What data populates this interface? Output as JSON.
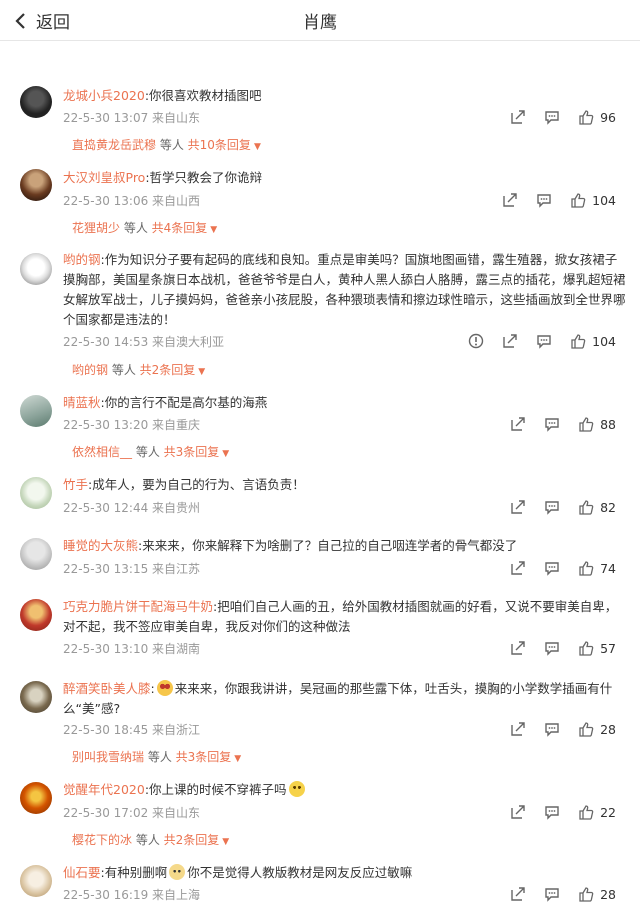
{
  "header": {
    "back_label": "返回",
    "title": "肖鹰"
  },
  "comments": [
    {
      "name": "龙城小兵2020",
      "text": ":你很喜欢教材插图吧",
      "meta": "22-5-30 13:07 来自山东",
      "likes": "96",
      "reply_name": "直捣黄龙岳武穆",
      "reply_mid": " 等人 ",
      "reply_more": "共10条回复"
    },
    {
      "name": "大汉刘皇叔Pro",
      "text": ":哲学只教会了你诡辩",
      "meta": "22-5-30 13:06 来自山西",
      "likes": "104",
      "reply_name": "花狸胡少",
      "reply_mid": " 等人 ",
      "reply_more": "共4条回复"
    },
    {
      "name": "哟的钢",
      "text": ":作为知识分子要有起码的底线和良知。重点是审美吗？国旗地图画错，露生殖器，掀女孩裙子摸胸部，美国星条旗日本战机，爸爸爷爷是白人，黄种人黑人舔白人胳膊，露三点的插花，爆乳超短裙女解放军战士，儿子摸妈妈，爸爸亲小孩屁股，各种猥琐表情和擦边球性暗示，这些插画放到全世界哪个国家都是违法的！",
      "meta": "22-5-30 14:53 来自澳大利亚",
      "likes": "104",
      "reply_name": "哟的钢",
      "reply_mid": " 等人 ",
      "reply_more": "共2条回复"
    },
    {
      "name": "晴蓝秋",
      "text": ":你的言行不配是高尔基的海燕",
      "meta": "22-5-30 13:20 来自重庆",
      "likes": "88",
      "reply_name": "依然相信__",
      "reply_mid": " 等人 ",
      "reply_more": "共3条回复"
    },
    {
      "name": "竹手",
      "text": ":成年人，要为自己的行为、言语负责！",
      "meta": "22-5-30 12:44 来自贵州",
      "likes": "82"
    },
    {
      "name": "睡觉的大灰熊",
      "text": ":来来来，你来解释下为啥删了？自己拉的自己咽连学者的骨气都没了",
      "meta": "22-5-30 13:15 来自江苏",
      "likes": "74"
    },
    {
      "name": "巧克力脆片饼干配海马牛奶",
      "text": ":把咱们自己人画的丑，给外国教材插图就画的好看，又说不要审美自卑，对不起，我不签应审美自卑，我反对你们的这种做法",
      "meta": "22-5-30 13:10 来自湖南",
      "likes": "57"
    },
    {
      "name": "醉酒笑卧美人膝",
      "text_a": ":",
      "text": "来来来，你跟我讲讲，吴冠画的那些露下体，吐舌头，摸胸的小学数学插画有什么“美”感?",
      "meta": "22-5-30 18:45 来自浙江",
      "likes": "28",
      "reply_name": "别叫我雪纳瑞",
      "reply_mid": " 等人 ",
      "reply_more": "共3条回复"
    },
    {
      "name": "觉醒年代2020",
      "text": ":你上课的时候不穿裤子吗",
      "meta": "22-5-30 17:02 来自山东",
      "likes": "22",
      "reply_name": "樱花下的冰",
      "reply_mid": " 等人 ",
      "reply_more": "共2条回复"
    },
    {
      "name": "仙石要",
      "text_a": ":有种别删啊",
      "text": "你不是觉得人教版教材是网友反应过敏嘛",
      "meta": "22-5-30 16:19 来自上海",
      "likes": "28"
    }
  ],
  "colors": {
    "name": "#eb7350",
    "meta": "#999999",
    "text": "#333333"
  }
}
